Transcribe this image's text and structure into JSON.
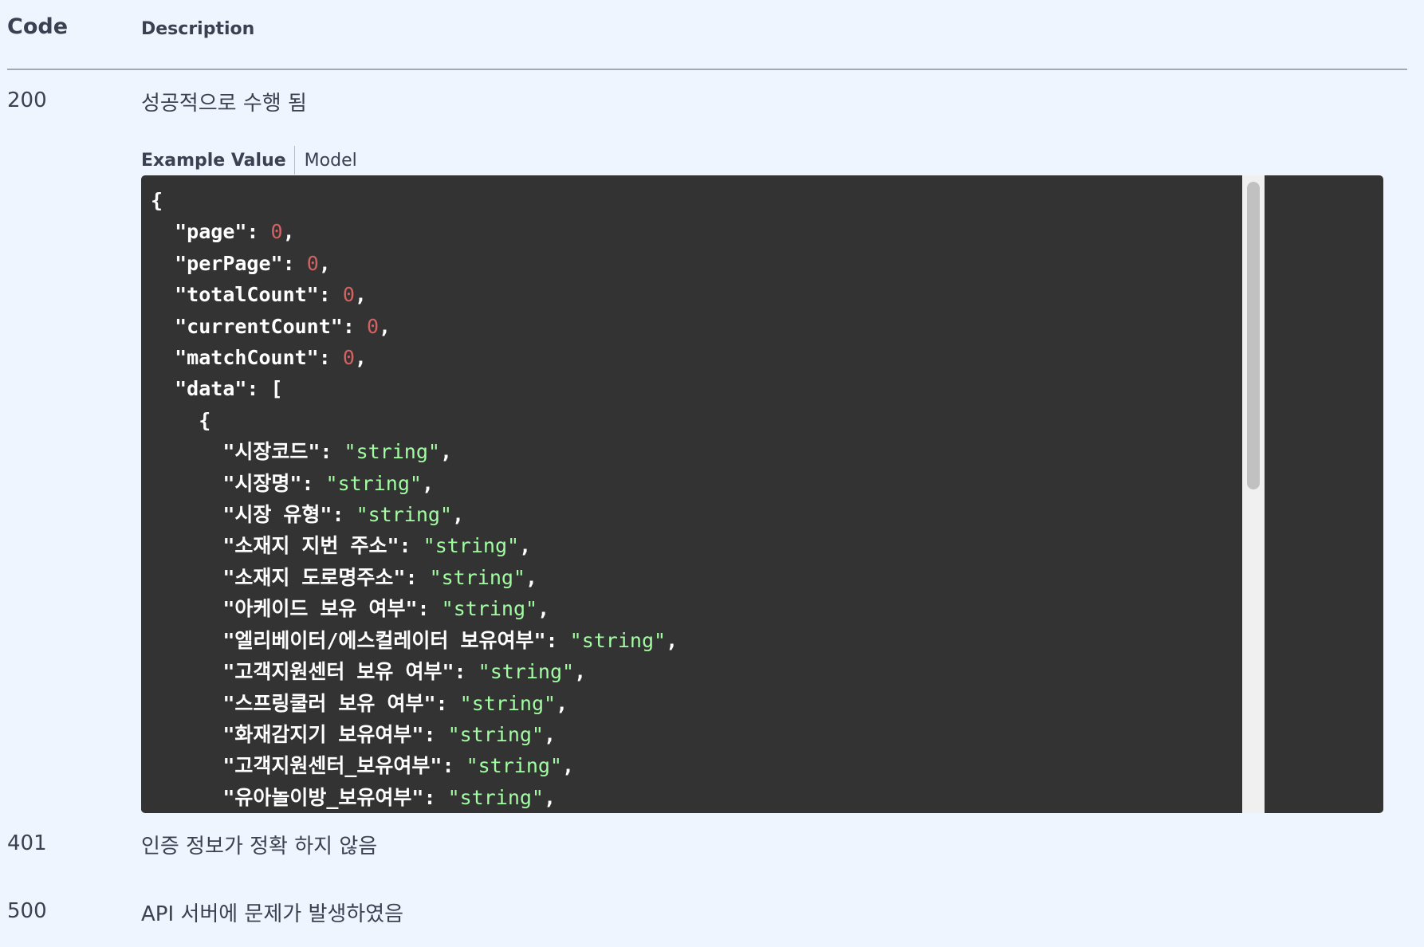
{
  "header": {
    "code_label": "Code",
    "description_label": "Description"
  },
  "responses": [
    {
      "code": "200",
      "description": "성공적으로 수행 됨"
    },
    {
      "code": "401",
      "description": "인증 정보가 정확 하지 않음"
    },
    {
      "code": "500",
      "description": "API 서버에 문제가 발생하였음"
    }
  ],
  "tabs": {
    "example_value": "Example Value",
    "model": "Model"
  },
  "example": {
    "open_brace": "{",
    "fields": [
      {
        "key": "\"page\"",
        "value": "0"
      },
      {
        "key": "\"perPage\"",
        "value": "0"
      },
      {
        "key": "\"totalCount\"",
        "value": "0"
      },
      {
        "key": "\"currentCount\"",
        "value": "0"
      },
      {
        "key": "\"matchCount\"",
        "value": "0"
      }
    ],
    "data_key": "\"data\"",
    "data_open": "[",
    "item_open": "{",
    "item_fields": [
      {
        "key": "\"시장코드\"",
        "value": "\"string\""
      },
      {
        "key": "\"시장명\"",
        "value": "\"string\""
      },
      {
        "key": "\"시장 유형\"",
        "value": "\"string\""
      },
      {
        "key": "\"소재지 지번 주소\"",
        "value": "\"string\""
      },
      {
        "key": "\"소재지 도로명주소\"",
        "value": "\"string\""
      },
      {
        "key": "\"아케이드 보유 여부\"",
        "value": "\"string\""
      },
      {
        "key": "\"엘리베이터/에스컬레이터 보유여부\"",
        "value": "\"string\""
      },
      {
        "key": "\"고객지원센터 보유 여부\"",
        "value": "\"string\""
      },
      {
        "key": "\"스프링쿨러 보유 여부\"",
        "value": "\"string\""
      },
      {
        "key": "\"화재감지기 보유여부\"",
        "value": "\"string\""
      },
      {
        "key": "\"고객지원센터_보유여부\"",
        "value": "\"string\""
      },
      {
        "key": "\"유아놀이방_보유여부\"",
        "value": "\"string\""
      }
    ]
  }
}
